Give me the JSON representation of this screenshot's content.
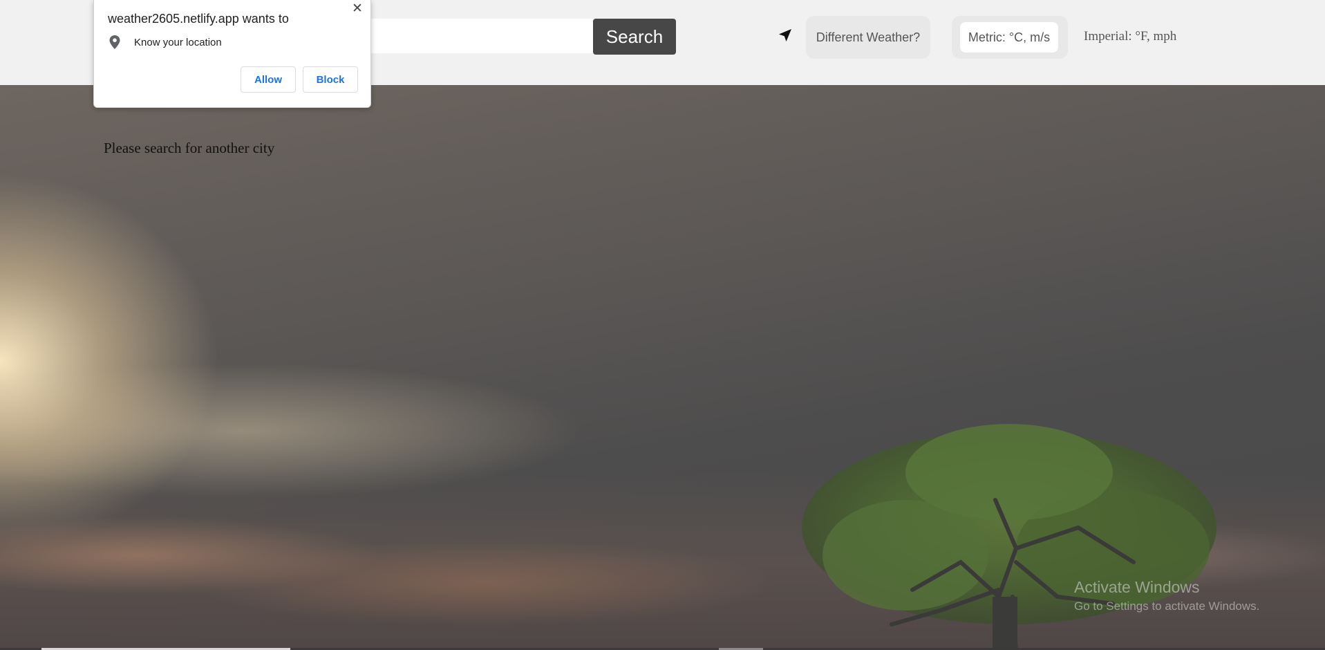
{
  "header": {
    "search": {
      "value": "",
      "placeholder": "",
      "button_label": "Search"
    },
    "locate_icon": "navigation-arrow-icon",
    "different_weather_label": "Different Weather?",
    "units": {
      "metric_label": "Metric: °C, m/s",
      "imperial_label": "Imperial: °F, mph",
      "selected": "metric"
    }
  },
  "main": {
    "message": "Please search for another city"
  },
  "permission_popup": {
    "title": "weather2605.netlify.app wants to",
    "permission_icon": "location-pin-icon",
    "permission_text": "Know your location",
    "allow_label": "Allow",
    "block_label": "Block",
    "close_glyph": "✕"
  },
  "watermark": {
    "title": "Activate Windows",
    "subtitle": "Go to Settings to activate Windows."
  },
  "colors": {
    "header_bg": "#f1f1f1",
    "search_button_bg": "#474747",
    "popup_button_text": "#1a73e8"
  }
}
